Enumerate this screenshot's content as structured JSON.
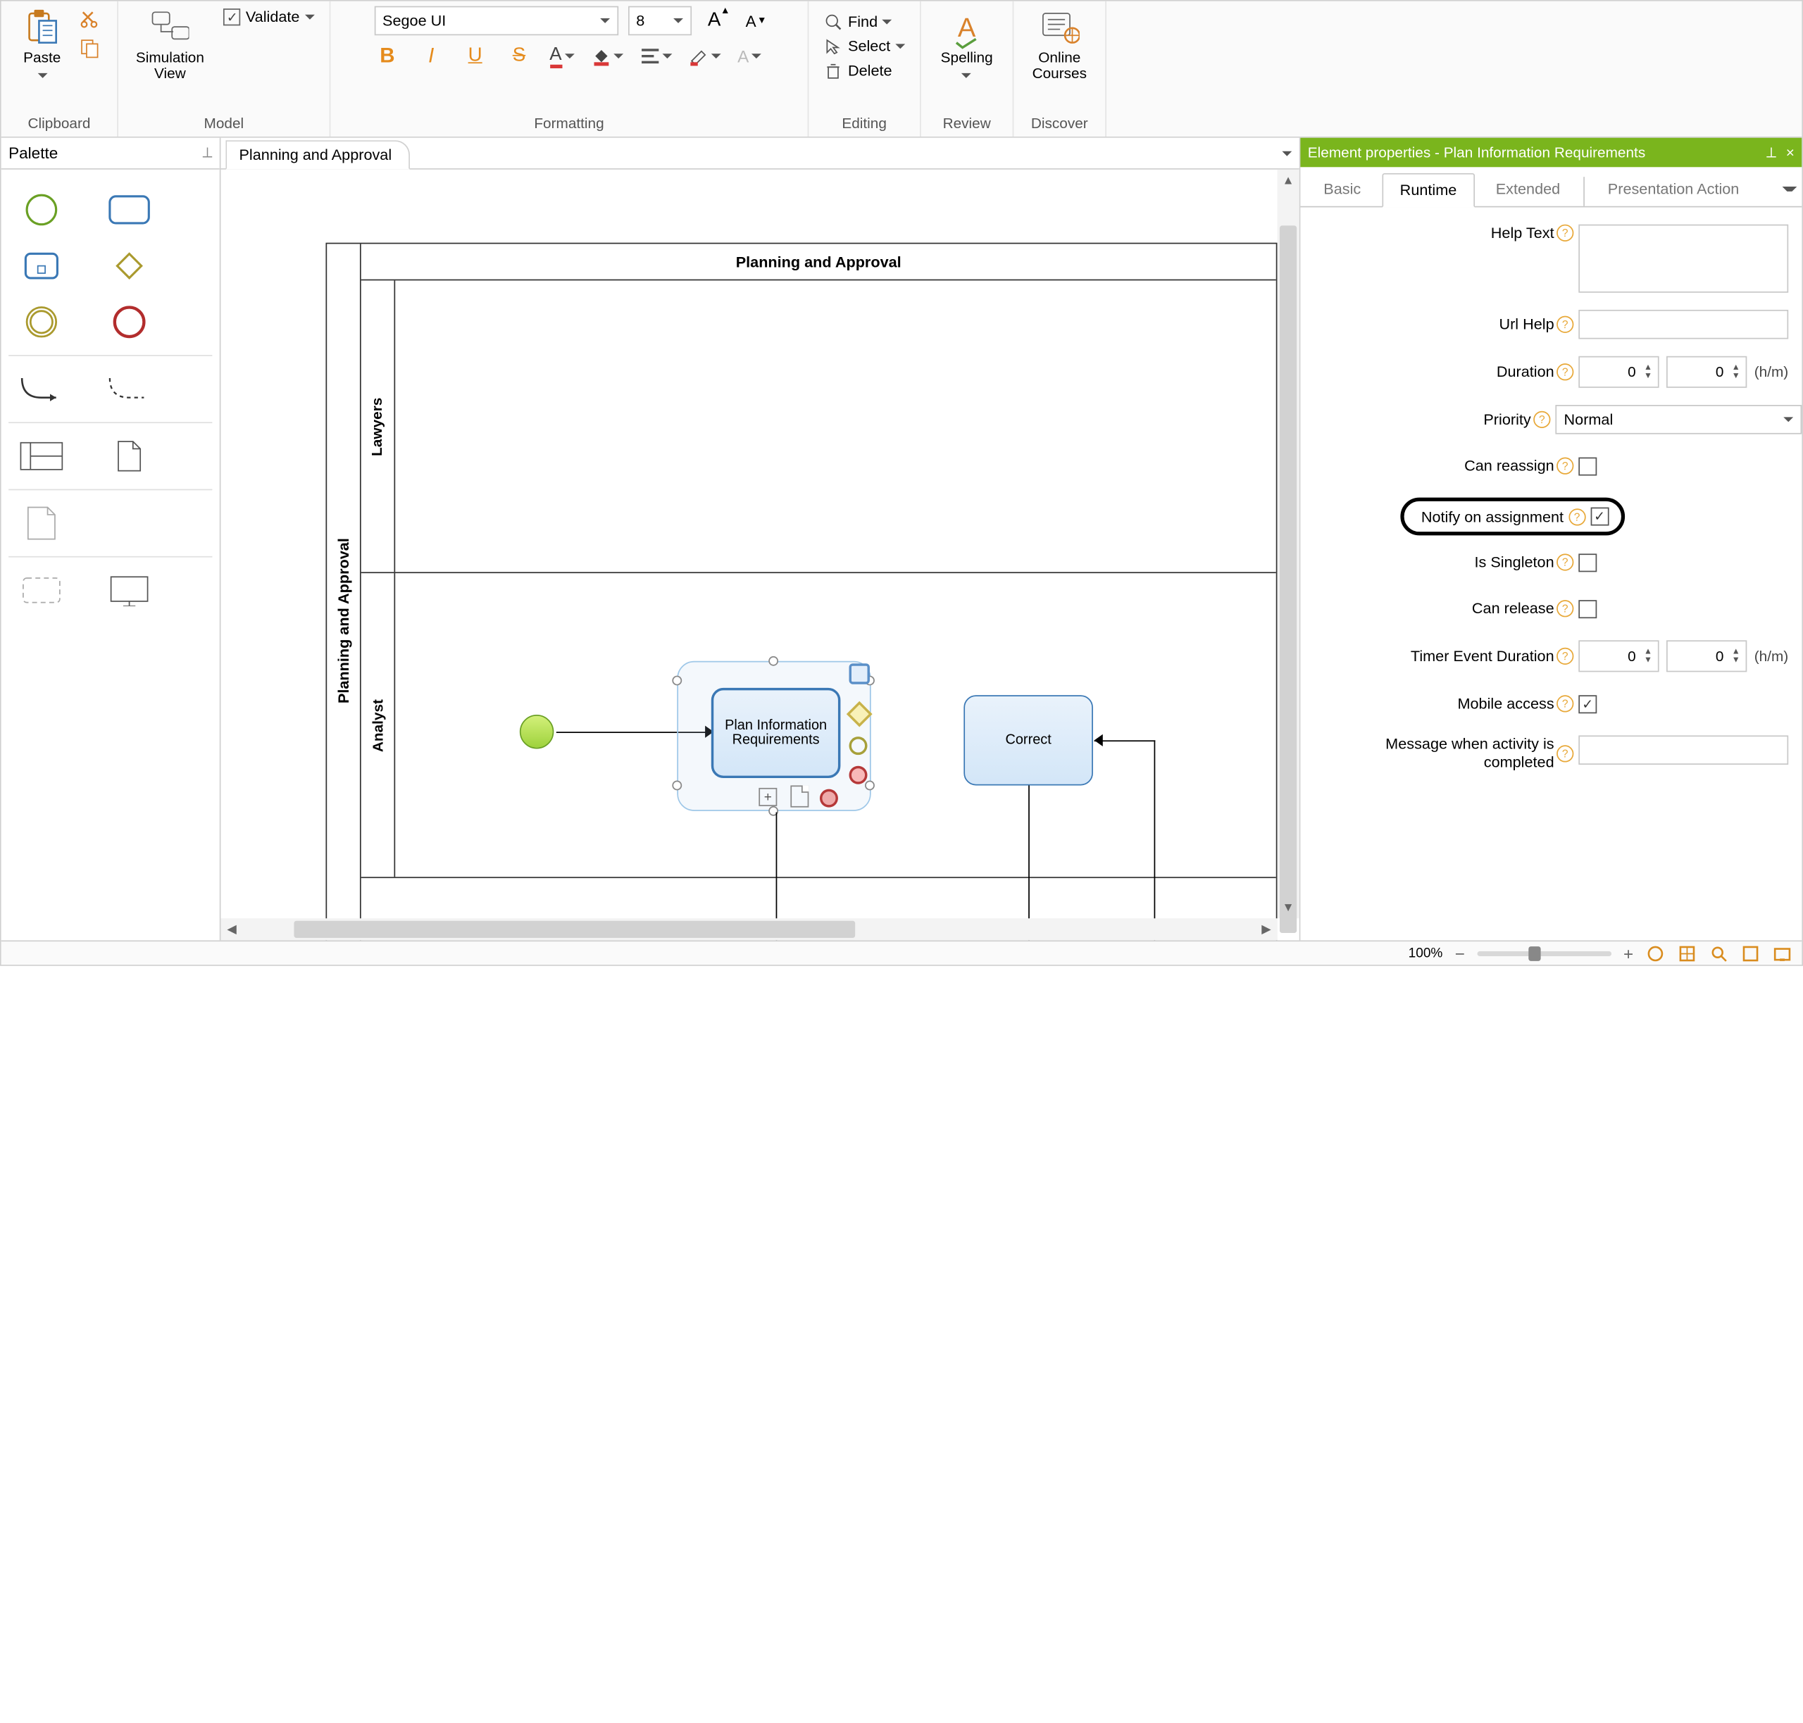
{
  "ribbon": {
    "clipboard": {
      "label": "Clipboard",
      "paste": "Paste"
    },
    "model": {
      "label": "Model",
      "sim_view": "Simulation\nView",
      "validate": "Validate"
    },
    "formatting": {
      "label": "Formatting",
      "font": "Segoe UI",
      "size": "8"
    },
    "editing": {
      "label": "Editing",
      "find": "Find",
      "select": "Select",
      "delete": "Delete"
    },
    "review": {
      "label": "Review",
      "spelling": "Spelling"
    },
    "discover": {
      "label": "Discover",
      "courses": "Online\nCourses"
    }
  },
  "palette": {
    "title": "Palette"
  },
  "doc": {
    "tab": "Planning and Approval"
  },
  "diagram": {
    "pool": "Planning and Approval",
    "pool_header": "Planning and Approval",
    "lane1": "Lawyers",
    "lane2": "Analyst",
    "task_plan": "Plan Information Requirements",
    "task_correct": "Correct"
  },
  "props": {
    "title": "Element properties - Plan Information Requirements",
    "tabs": {
      "basic": "Basic",
      "runtime": "Runtime",
      "extended": "Extended",
      "presentation": "Presentation Action"
    },
    "help_text": "Help Text",
    "url_help": "Url Help",
    "duration": "Duration",
    "duration_h": "0",
    "duration_m": "0",
    "hm": "(h/m)",
    "priority": "Priority",
    "priority_val": "Normal",
    "can_reassign": "Can reassign",
    "notify": "Notify on assignment",
    "singleton": "Is Singleton",
    "can_release": "Can release",
    "timer_dur": "Timer Event Duration",
    "timer_h": "0",
    "timer_m": "0",
    "mobile": "Mobile access",
    "msg_complete": "Message when activity is completed"
  },
  "status": {
    "zoom": "100%"
  }
}
